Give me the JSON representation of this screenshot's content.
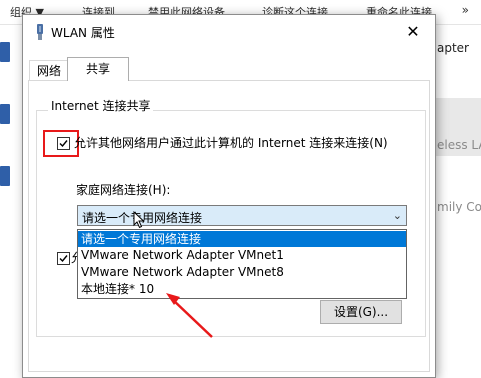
{
  "background_window": {
    "toolbar_items": [
      "组织 ▼",
      "连接到",
      "禁用此网络设备",
      "诊断这个连接",
      "重命名此连接"
    ],
    "more_label": "»",
    "right_snippets": [
      "apter",
      "eless LA",
      "mily Co"
    ]
  },
  "dialog": {
    "title": "WLAN 属性",
    "close_label": "✕",
    "tabs": [
      {
        "label": "网络",
        "active": false
      },
      {
        "label": "共享",
        "active": true
      }
    ],
    "group_title": "Internet 连接共享",
    "allow_share": {
      "checked": true,
      "label": "允许其他网络用户通过此计算机的 Internet 连接来连接(N)"
    },
    "home_network_label": "家庭网络连接(H):",
    "combo_value": "请选一个专用网络连接",
    "dropdown_options": [
      "请选一个专用网络连接",
      "VMware Network Adapter VMnet1",
      "VMware Network Adapter VMnet8",
      "本地连接* 10"
    ],
    "selected_option_index": 0,
    "second_checkbox": {
      "checked": true,
      "label_visible": "允"
    },
    "settings_button": "设置(G)..."
  },
  "annotation_color": "#e8191a",
  "accent_color": "#0078d7"
}
